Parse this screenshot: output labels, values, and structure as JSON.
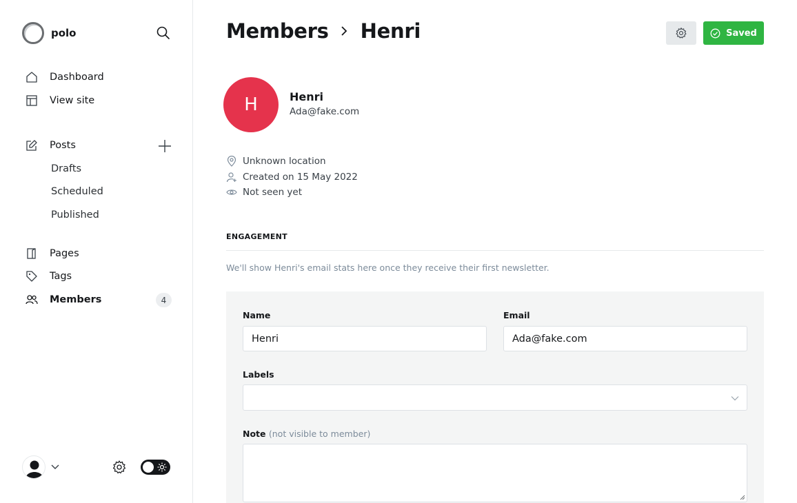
{
  "sidebar": {
    "site_name": "polo",
    "nav": {
      "dashboard": "Dashboard",
      "view_site": "View site",
      "posts": "Posts",
      "drafts": "Drafts",
      "scheduled": "Scheduled",
      "published": "Published",
      "pages": "Pages",
      "tags": "Tags",
      "members": "Members",
      "members_count": "4"
    }
  },
  "header": {
    "breadcrumb_parent": "Members",
    "breadcrumb_current": "Henri",
    "saved_label": "Saved"
  },
  "member": {
    "initial": "H",
    "name": "Henri",
    "email": "Ada@fake.com",
    "location": "Unknown location",
    "created": "Created on 15 May 2022",
    "last_seen": "Not seen yet",
    "avatar_color": "#e5334c"
  },
  "engagement": {
    "title": "ENGAGEMENT",
    "hint": "We'll show Henri's email stats here once they receive their first newsletter."
  },
  "form": {
    "name_label": "Name",
    "name_value": "Henri",
    "email_label": "Email",
    "email_value": "Ada@fake.com",
    "labels_label": "Labels",
    "note_label": "Note",
    "note_sub": "(not visible to member)"
  },
  "colors": {
    "accent_green": "#2fb542",
    "text": "#15171a",
    "muted": "#7c8b9a"
  }
}
